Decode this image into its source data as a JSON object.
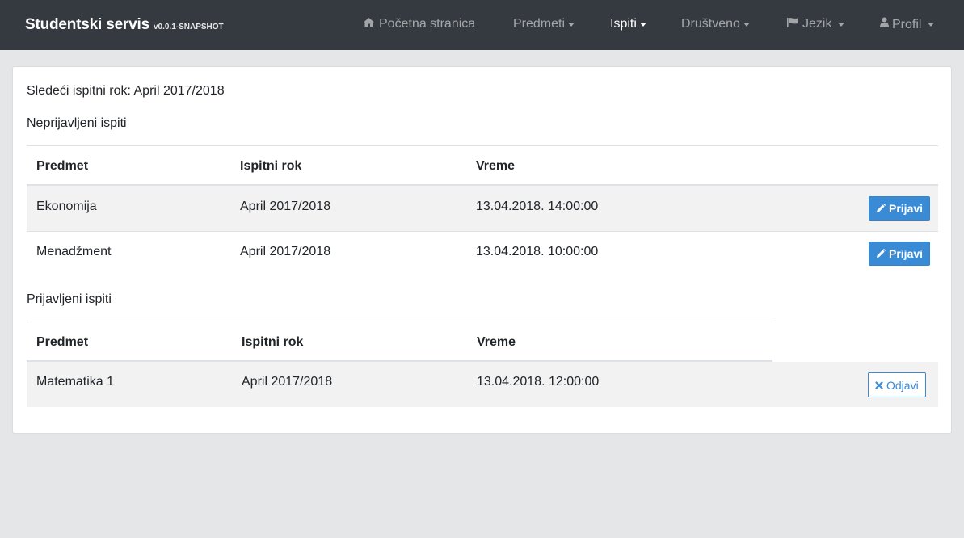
{
  "navbar": {
    "brand": "Studentski servis",
    "version": "v0.0.1-SNAPSHOT",
    "items": [
      {
        "label": "Početna stranica",
        "icon": "home-icon"
      },
      {
        "label": "Predmeti",
        "icon": "caret-down-icon"
      },
      {
        "label": "Ispiti",
        "icon": "caret-down-icon"
      },
      {
        "label": "Društveno",
        "icon": "caret-down-icon"
      },
      {
        "label": "Jezik",
        "icon": "flag-icon"
      },
      {
        "label": "Profil",
        "icon": "user-icon"
      }
    ]
  },
  "main": {
    "next_term": "Sledeći ispitni rok: April 2017/2018",
    "unregistered_title": "Neprijavljeni ispiti",
    "registered_title": "Prijavljeni ispiti",
    "headers": {
      "subject": "Predmet",
      "term": "Ispitni rok",
      "time": "Vreme"
    },
    "unregistered": [
      {
        "subject": "Ekonomija",
        "term": "April 2017/2018",
        "time": "13.04.2018. 14:00:00",
        "action": "Prijavi"
      },
      {
        "subject": "Menadžment",
        "term": "April 2017/2018",
        "time": "13.04.2018. 10:00:00",
        "action": "Prijavi"
      }
    ],
    "registered": [
      {
        "subject": "Matematika 1",
        "term": "April 2017/2018",
        "time": "13.04.2018. 12:00:00",
        "action": "Odjavi"
      }
    ]
  },
  "colors": {
    "navbar_bg": "#343a40",
    "primary": "#3a8bd6",
    "stripe": "#f2f2f2"
  }
}
